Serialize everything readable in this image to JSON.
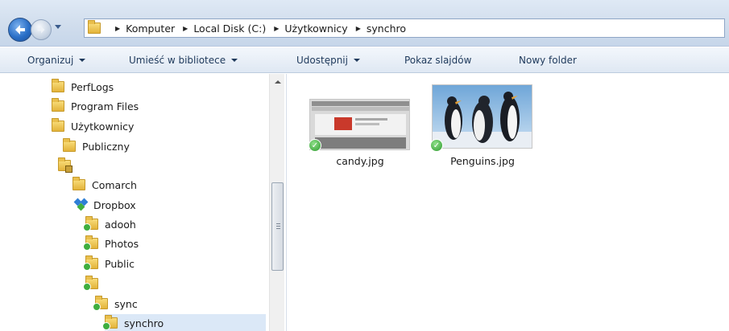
{
  "address_bar": {
    "breadcrumbs": [
      "Komputer",
      "Local Disk (C:)",
      "Użytkownicy",
      "synchro"
    ]
  },
  "toolbar": {
    "organize_label": "Organizuj",
    "library_label": "Umieść w bibliotece",
    "share_label": "Udostępnij",
    "slideshow_label": "Pokaz slajdów",
    "new_folder_label": "Nowy folder"
  },
  "nav_tree": {
    "items": [
      {
        "label": "PerfLogs"
      },
      {
        "label": "Program Files"
      },
      {
        "label": "Użytkownicy"
      },
      {
        "label": "Publiczny"
      },
      {
        "label": ""
      },
      {
        "label": "Comarch"
      },
      {
        "label": "Dropbox"
      },
      {
        "label": "adooh"
      },
      {
        "label": "Photos"
      },
      {
        "label": "Public"
      },
      {
        "label": ""
      },
      {
        "label": "sync"
      },
      {
        "label": "synchro"
      }
    ]
  },
  "files": [
    {
      "name": "candy.jpg",
      "status": "synced"
    },
    {
      "name": "Penguins.jpg",
      "status": "synced"
    }
  ],
  "colors": {
    "sync_status": "#2f9b2f",
    "toolbar_text": "#1e395b",
    "selection": "#dbe8f7"
  }
}
